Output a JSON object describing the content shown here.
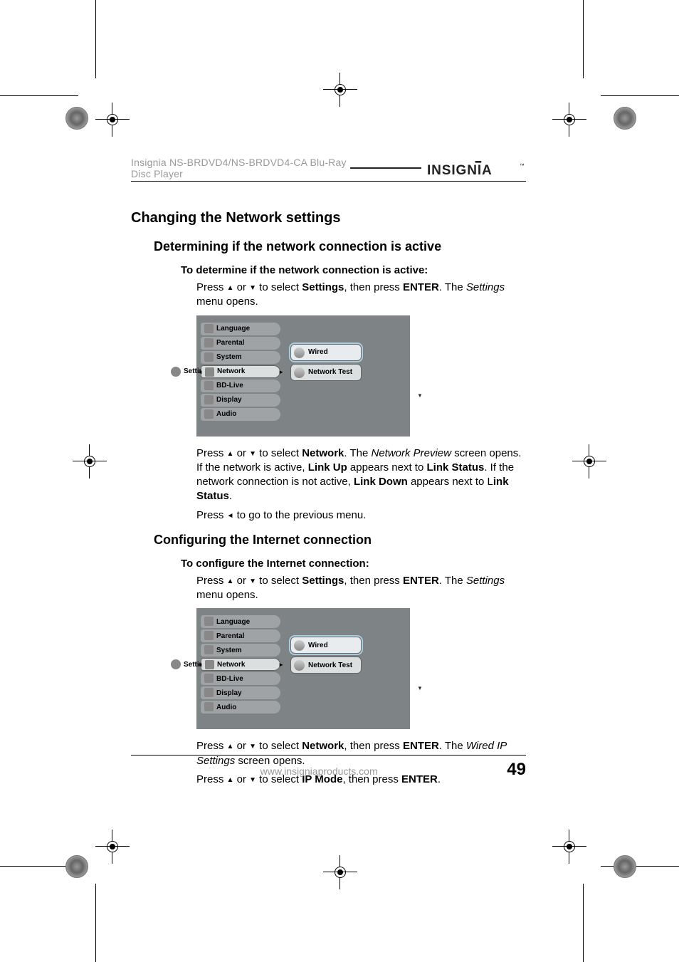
{
  "header": {
    "product_line": "Insignia NS-BRDVD4/NS-BRDVD4-CA Blu-Ray Disc Player",
    "brand": "INSIGNIA"
  },
  "sections": {
    "h1": "Changing the Network settings",
    "h2a": "Determining if the network connection is active",
    "h3a": "To determine if the network connection is active:",
    "p1_pre": "Press ",
    "p1_mid": " or ",
    "p1_sel": " to select ",
    "p1_settings": "Settings",
    "p1_then": ", then press ",
    "p1_enter": "ENTER",
    "p1_after": ". The ",
    "p1_settings_i": "Settings",
    "p1_tail": " menu opens.",
    "p2_pre": "Press ",
    "p2_mid": " or ",
    "p2_sel": " to select ",
    "p2_network": "Network",
    "p2_after": ". The ",
    "p2_np_i": "Network Preview",
    "p2_s2": " screen opens. If the network is active, ",
    "p2_linkup": "Link Up",
    "p2_s3": " appears next to ",
    "p2_linkstatus": "Link Status",
    "p2_s4": ". If the network connection is not active, ",
    "p2_linkdown": "Link Down",
    "p2_s5": " appears next to L",
    "p2_linkstatus2": "ink Status",
    "p2_s6": ".",
    "p3_pre": "Press ",
    "p3_tail": " to go to the previous menu.",
    "h2b": "Configuring the Internet connection",
    "h3b": "To configure the Internet connection:",
    "p4_pre": "Press ",
    "p4_mid": " or ",
    "p4_sel": " to select ",
    "p4_settings": "Settings",
    "p4_then": ", then press ",
    "p4_enter": "ENTER",
    "p4_after": ". The ",
    "p4_settings_i": "Settings",
    "p4_tail": " menu opens.",
    "p5_pre": "Press ",
    "p5_mid": " or ",
    "p5_sel": " to select ",
    "p5_network": "Network",
    "p5_then": ", then press ",
    "p5_enter": "ENTER",
    "p5_after": ". The ",
    "p5_wip_i": "Wired IP Settings",
    "p5_tail": " screen opens.",
    "p6_pre": "Press ",
    "p6_mid": " or ",
    "p6_sel": " to select ",
    "p6_ipmode": "IP Mode",
    "p6_then": ", then press ",
    "p6_enter": "ENTER",
    "p6_tail": "."
  },
  "ui": {
    "settings_label": "Settings",
    "menu": {
      "language": "Language",
      "parental": "Parental",
      "system": "System",
      "network": "Network",
      "bdlive": "BD-Live",
      "display": "Display",
      "audio": "Audio"
    },
    "right": {
      "wired": "Wired",
      "network_test": "Network Test"
    }
  },
  "footer": {
    "url": "www.insigniaproducts.com",
    "page": "49"
  }
}
